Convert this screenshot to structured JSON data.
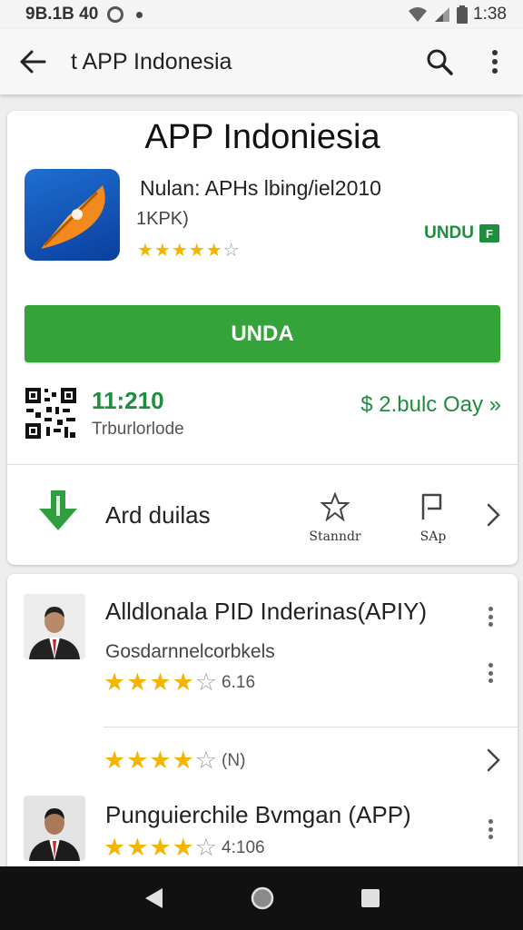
{
  "status_bar": {
    "time_left": "9B.1B 40",
    "time_right": "1:38"
  },
  "app_bar": {
    "title": "t APP Indonesia"
  },
  "app": {
    "title": "APP Indoniesia",
    "developer_line": "Nulan: APHs lbing/iel2010",
    "size": "1KPK)",
    "rating_stars": 4.5,
    "undu_link": "UNDU",
    "undu_badge": "F"
  },
  "install_button": "UNDA",
  "stats": {
    "value": "11:210",
    "label": "Trburlorlode",
    "price": "$ 2.bulc Oay »"
  },
  "actions": {
    "download_label": "Ard duilas",
    "action1_label": "Stanndr",
    "action2_label": "SAp"
  },
  "list": {
    "item1": {
      "title": "Alldlonala PID Inderinas(APIY)",
      "subtitle": "Gosdarnnelcorbkels",
      "rating_stars": 3.5,
      "rating_value": "6.16"
    },
    "item2": {
      "rating_stars": 3.5,
      "rating_value": "(N)"
    },
    "item3": {
      "title": "Punguierchile Bvmgan (APP)",
      "rating_stars": 4,
      "rating_value": "4:106"
    }
  },
  "colors": {
    "accent_green": "#34a33a",
    "link_green": "#1e8e3e",
    "star_yellow": "#f4b400",
    "icon_blue": "#1e6fd1",
    "icon_orange": "#f28a1e"
  }
}
